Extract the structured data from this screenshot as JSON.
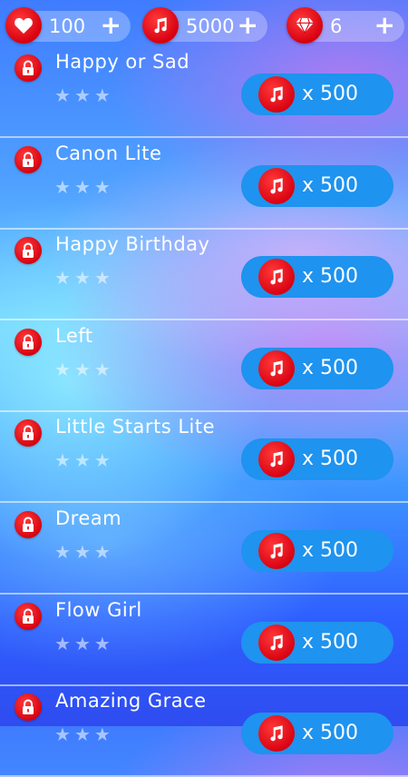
{
  "topbar": {
    "lives": {
      "icon": "heart-icon",
      "value": "100"
    },
    "notes": {
      "icon": "music-note-icon",
      "value": "5000"
    },
    "gems": {
      "icon": "diamond-icon",
      "value": "6"
    },
    "plus": "+"
  },
  "star_glyph": "★",
  "songs": [
    {
      "title": "Happy or Sad",
      "price": "x 500",
      "stars": 0,
      "locked": true
    },
    {
      "title": "Canon Lite",
      "price": "x 500",
      "stars": 0,
      "locked": true
    },
    {
      "title": "Happy Birthday",
      "price": "x 500",
      "stars": 0,
      "locked": true
    },
    {
      "title": "Left",
      "price": "x 500",
      "stars": 0,
      "locked": true
    },
    {
      "title": "Little Starts Lite",
      "price": "x 500",
      "stars": 0,
      "locked": true
    },
    {
      "title": "Dream",
      "price": "x 500",
      "stars": 0,
      "locked": true
    },
    {
      "title": "Flow Girl",
      "price": "x 500",
      "stars": 0,
      "locked": true
    },
    {
      "title": "Amazing Grace",
      "price": "x 500",
      "stars": 0,
      "locked": true
    }
  ],
  "colors": {
    "accent_red": "#e0000f",
    "buy_button": "#1e93ef"
  }
}
